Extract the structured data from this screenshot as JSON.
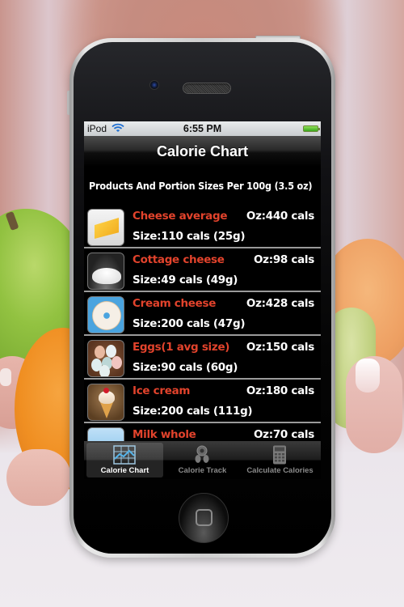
{
  "status_bar": {
    "carrier": "iPod",
    "time": "6:55 PM"
  },
  "nav": {
    "title": "Calorie Chart"
  },
  "section_header": "Products And Portion Sizes  Per 100g (3.5 oz)",
  "items": [
    {
      "name": "Cheese average",
      "oz": "Oz:440 cals",
      "size": "Size:110 cals (25g)",
      "icon": "cheese-icon"
    },
    {
      "name": "Cottage cheese",
      "oz": "Oz:98 cals",
      "size": "Size:49 cals (49g)",
      "icon": "cottage-cheese-icon"
    },
    {
      "name": "Cream cheese",
      "oz": "Oz:428 cals",
      "size": "Size:200 cals (47g)",
      "icon": "cream-cheese-bagel-icon"
    },
    {
      "name": "Eggs(1 avg size)",
      "oz": "Oz:150 cals",
      "size": "Size:90 cals (60g)",
      "icon": "eggs-icon"
    },
    {
      "name": "Ice cream",
      "oz": "Oz:180 cals",
      "size": "Size:200 cals (111g)",
      "icon": "ice-cream-icon"
    },
    {
      "name": "Milk whole",
      "oz": "Oz:70 cals",
      "size": "",
      "icon": "milk-icon"
    }
  ],
  "tabs": [
    {
      "label": "Calorie Chart",
      "icon": "chart-icon",
      "active": true
    },
    {
      "label": "Calorie Track",
      "icon": "scale-footprints-icon",
      "active": false
    },
    {
      "label": "Calculate Calories",
      "icon": "calculator-icon",
      "active": false
    }
  ],
  "colors": {
    "item_name": "#e2432c",
    "text": "#ffffff",
    "background": "#000000",
    "tab_active_label": "#ffffff",
    "tab_inactive_label": "#8a8a8a"
  }
}
